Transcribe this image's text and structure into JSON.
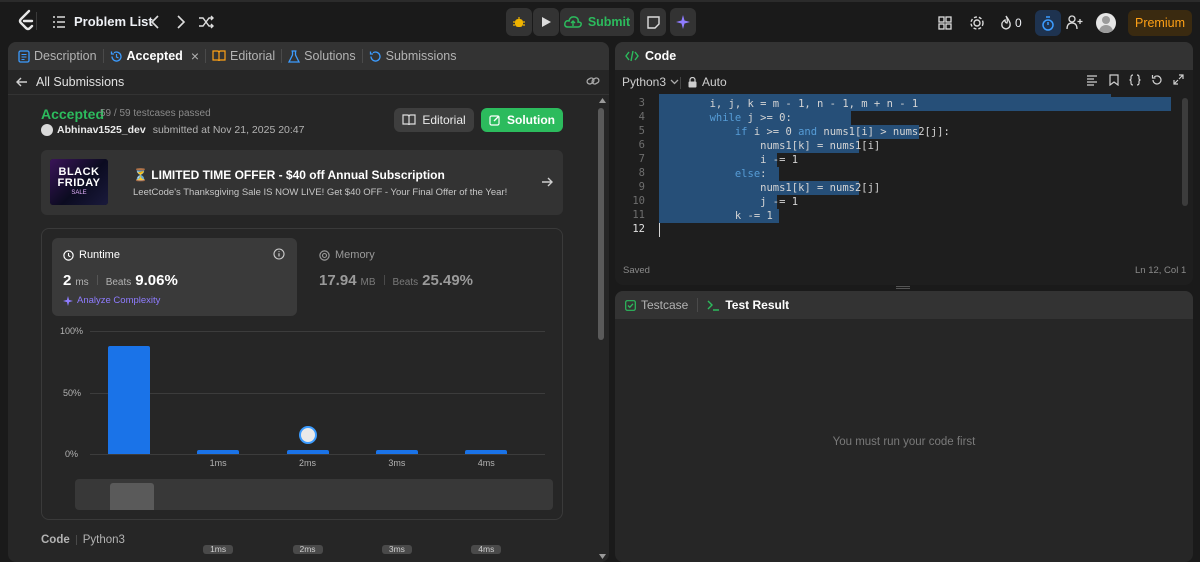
{
  "topbar": {
    "problem_list": "Problem List",
    "submit": "Submit",
    "streak_count": "0",
    "premium": "Premium"
  },
  "left_tabs": [
    {
      "label": "Description",
      "icon": "description-icon"
    },
    {
      "label": "Accepted",
      "icon": "accepted-icon",
      "active": true
    },
    {
      "label": "Editorial",
      "icon": "book-icon"
    },
    {
      "label": "Solutions",
      "icon": "flask-icon"
    },
    {
      "label": "Submissions",
      "icon": "history-icon"
    }
  ],
  "submission": {
    "back_label": "All Submissions",
    "status": "Accepted",
    "testcases": "59 / 59 testcases passed",
    "user": "Abhinav1525_dev",
    "submitted_at": "submitted at Nov 21, 2025 20:47",
    "editorial_btn": "Editorial",
    "solution_btn": "Solution"
  },
  "promo": {
    "img_line1": "BLACK",
    "img_line2": "FRIDAY",
    "img_line3": "SALE",
    "title": "⏳ LIMITED TIME OFFER - $40 off Annual Subscription",
    "subtitle": "LeetCode's Thanksgiving Sale IS NOW LIVE! Get $40 OFF - Your Final Offer of the Year!"
  },
  "stats": {
    "runtime_label": "Runtime",
    "runtime_value": "2",
    "runtime_unit": "ms",
    "beats_label": "Beats",
    "runtime_beats": "9.06%",
    "analyze": "Analyze Complexity",
    "memory_label": "Memory",
    "memory_value": "17.94",
    "memory_unit": "MB",
    "memory_beats": "25.49%"
  },
  "chart_data": {
    "type": "bar",
    "categories": [
      "",
      "1ms",
      "2ms",
      "3ms",
      "4ms"
    ],
    "values": [
      88,
      3,
      3,
      3,
      3
    ],
    "y_ticks": [
      "100%",
      "50%",
      "0%"
    ],
    "ylim": [
      0,
      100
    ],
    "highlight_category": "2ms",
    "mini_categories": [
      "1ms",
      "2ms",
      "3ms",
      "4ms"
    ]
  },
  "bottom_code": {
    "label": "Code",
    "lang": "Python3"
  },
  "code_panel": {
    "title": "Code",
    "language": "Python3",
    "auto": "Auto",
    "saved": "Saved",
    "cursor": "Ln 12, Col 1",
    "lines": [
      {
        "n": "3",
        "text": "        i, j, k = m - 1, n - 1, m + n - 1"
      },
      {
        "n": "4",
        "text": "        while j >= 0:"
      },
      {
        "n": "5",
        "text": "            if i >= 0 and nums1[i] > nums2[j]:"
      },
      {
        "n": "6",
        "text": "                nums1[k] = nums1[i]"
      },
      {
        "n": "7",
        "text": "                i -= 1"
      },
      {
        "n": "8",
        "text": "            else:"
      },
      {
        "n": "9",
        "text": "                nums1[k] = nums2[j]"
      },
      {
        "n": "10",
        "text": "                j -= 1"
      },
      {
        "n": "11",
        "text": "            k -= 1"
      },
      {
        "n": "12",
        "text": ""
      }
    ]
  },
  "test_panel": {
    "testcase": "Testcase",
    "test_result": "Test Result",
    "empty_msg": "You must run your code first"
  },
  "colors": {
    "accepted": "#2cbb5d",
    "accent_blue": "#1a73e8",
    "premium": "#ffa116",
    "selection": "#264f78"
  }
}
